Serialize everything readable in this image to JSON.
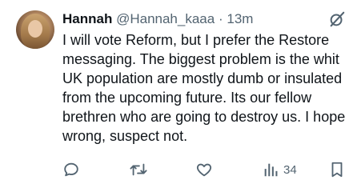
{
  "tweet": {
    "author_name": "Hannah",
    "handle": "@Hannah_kaaa",
    "separator": "·",
    "time": "13m",
    "text_lines": [
      "I will vote Reform, but I prefer the Restore",
      "messaging.   The biggest problem is the whit",
      "UK population are mostly dumb or insulated",
      "from the upcoming future. Its our fellow",
      "brethren who are going to destroy us.  I hope",
      "wrong, suspect not."
    ]
  },
  "actions": {
    "views_count": "34"
  },
  "icons": {
    "header_right": "grok-icon",
    "reply": "reply-icon",
    "repost": "repost-icon",
    "like": "like-icon",
    "views": "views-icon",
    "bookmark": "bookmark-icon"
  },
  "colors": {
    "text": "#0f1419",
    "secondary": "#536471",
    "background": "#ffffff"
  }
}
